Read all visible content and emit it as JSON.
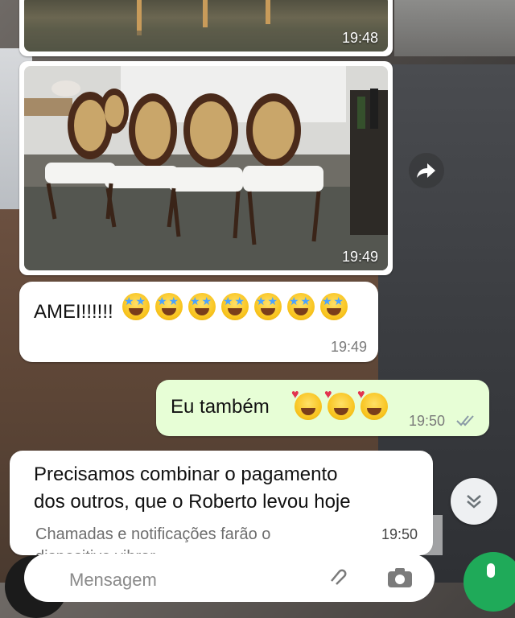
{
  "messages": [
    {
      "type": "image",
      "time": "19:48"
    },
    {
      "type": "image",
      "time": "19:49"
    },
    {
      "type": "text",
      "direction": "in",
      "text": "AMEI!!!!!!",
      "emoji_count": 7,
      "emoji": "star-struck",
      "time": "19:49"
    },
    {
      "type": "text",
      "direction": "out",
      "text": "Eu também",
      "emoji_count": 3,
      "emoji": "smiling-face-with-hearts",
      "time": "19:50",
      "status": "read-double-check"
    },
    {
      "type": "text",
      "direction": "in",
      "line1": "Precisamos combinar o pagamento",
      "line2": "dos outros,  que o Roberto levou hoje",
      "time": "19:50"
    }
  ],
  "notification": {
    "line1": "Chamadas e notificações farão o",
    "line2": "dispositivo vibrar"
  },
  "compose": {
    "placeholder": "Mensagem"
  },
  "colors": {
    "outgoing_bubble": "#e7fed6",
    "incoming_bubble": "#ffffff",
    "read_check": "#8a9aa6",
    "mic_button": "#1faa59"
  },
  "icons": [
    "forward-icon",
    "chevron-double-down-icon",
    "double-check-icon",
    "paperclip-icon",
    "camera-icon",
    "mic-icon"
  ]
}
